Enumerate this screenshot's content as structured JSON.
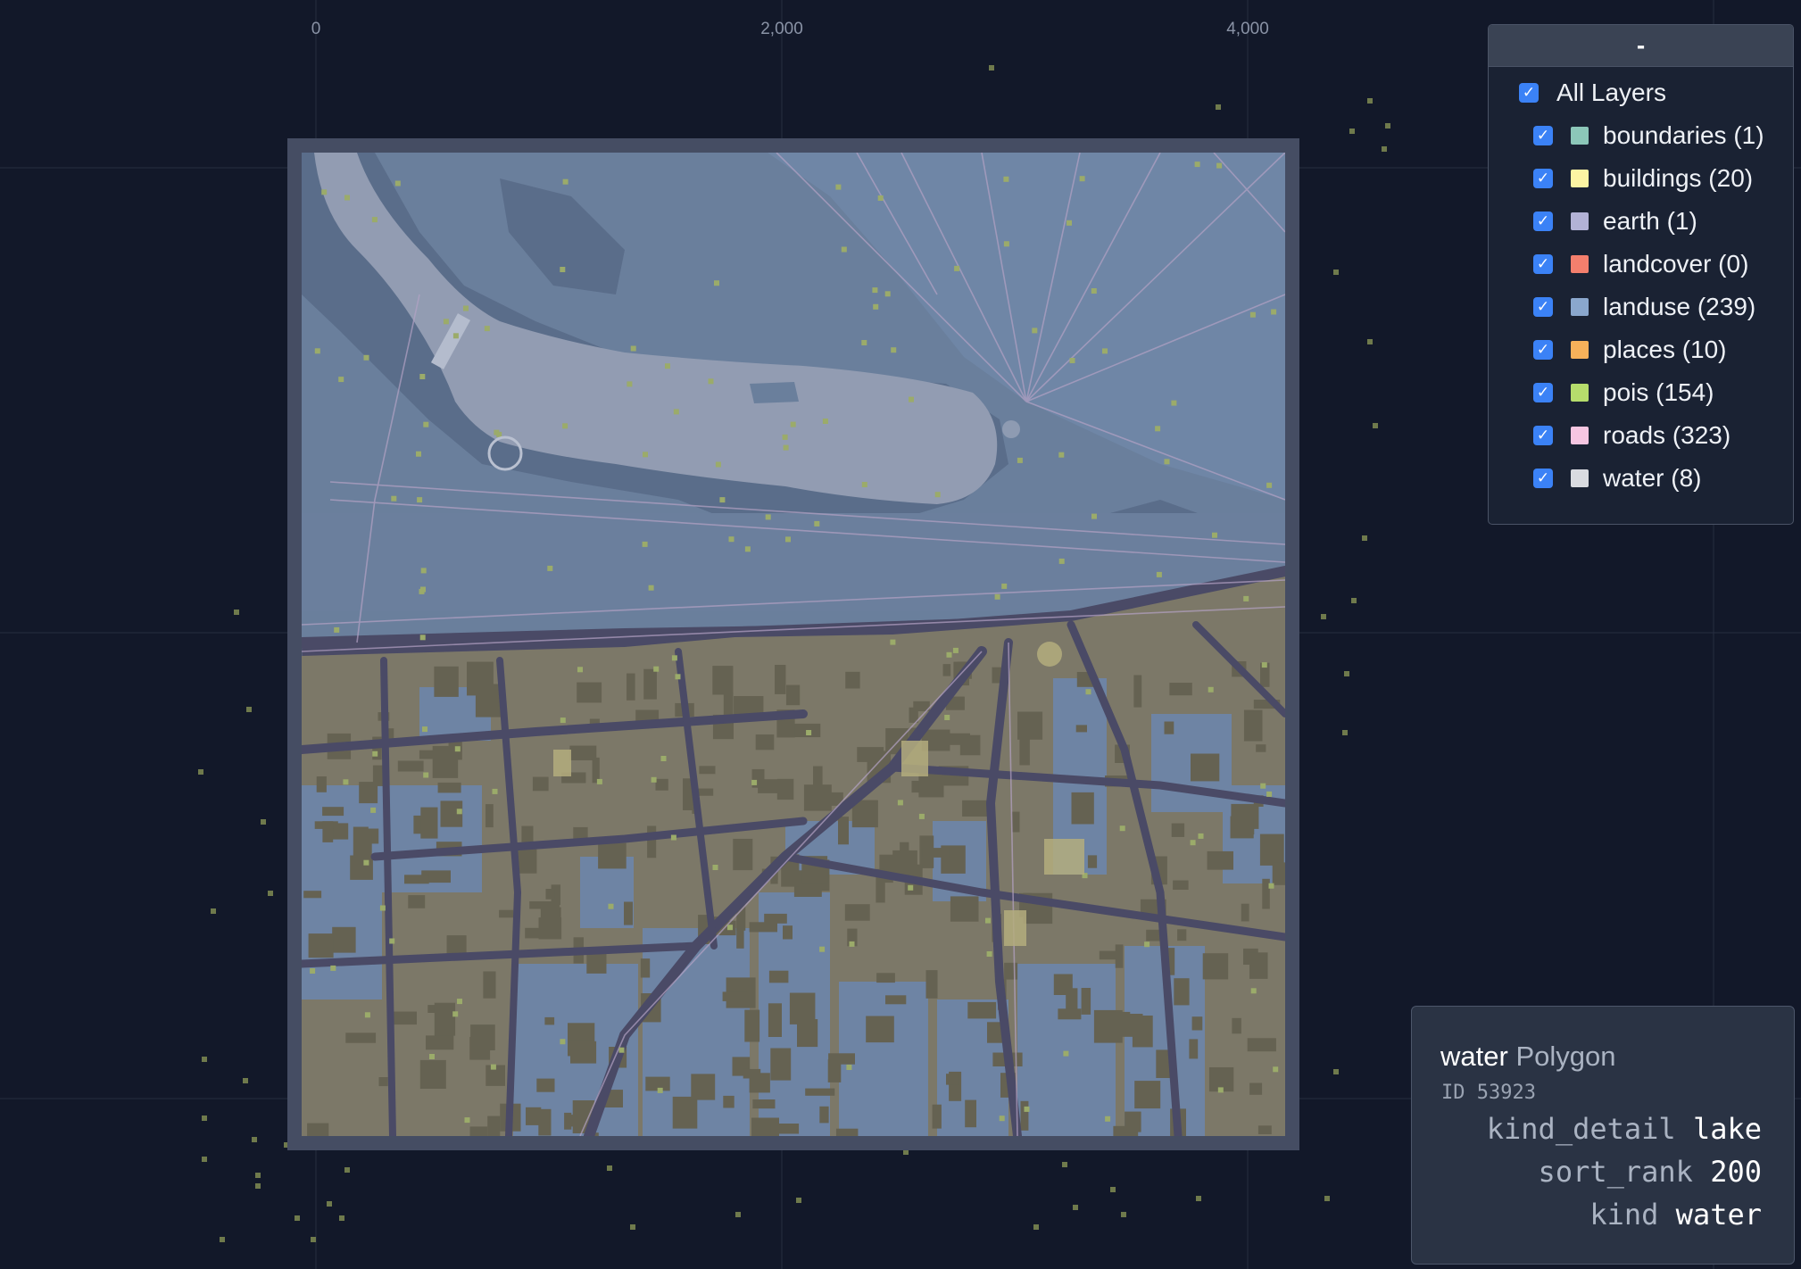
{
  "axis": {
    "labels": [
      "0",
      "2,000",
      "4,000"
    ]
  },
  "layers_panel": {
    "collapse_label": "-",
    "all_label": "All Layers",
    "items": [
      {
        "label": "boundaries (1)",
        "color": "#8cc7b9"
      },
      {
        "label": "buildings (20)",
        "color": "#fcf4a3"
      },
      {
        "label": "earth (1)",
        "color": "#b2b2d6"
      },
      {
        "label": "landcover (0)",
        "color": "#f37f6d"
      },
      {
        "label": "landuse (239)",
        "color": "#8aa7cd"
      },
      {
        "label": "places (10)",
        "color": "#f7b15a"
      },
      {
        "label": "pois (154)",
        "color": "#b6dd6c"
      },
      {
        "label": "roads (323)",
        "color": "#f6c6e2"
      },
      {
        "label": "water (8)",
        "color": "#d9dbe0"
      }
    ]
  },
  "feature_info": {
    "layer": "water",
    "geometry_type": "Polygon",
    "id_text": "ID 53923",
    "properties": [
      {
        "key": "kind_detail",
        "value": "lake"
      },
      {
        "key": "sort_rank",
        "value": "200"
      },
      {
        "key": "kind",
        "value": "water"
      }
    ]
  },
  "colors": {
    "background": "#121829",
    "tile_frame": "#454d63",
    "landuse": "#6a7f9c",
    "water": "#929cb2",
    "urban": "#7c7868",
    "road": "#4a4a66",
    "poi": "#9bab6a",
    "accent": "#3b82f6"
  }
}
